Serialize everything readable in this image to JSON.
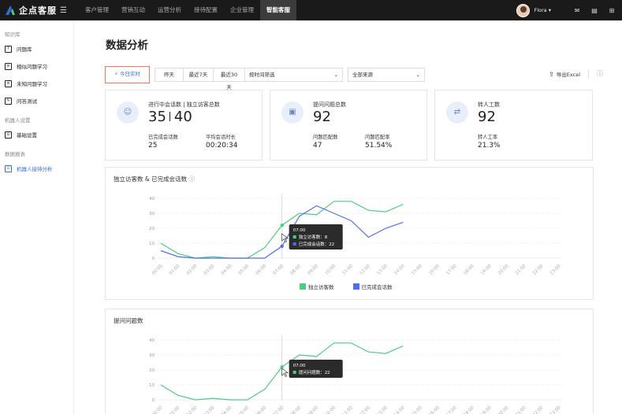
{
  "app": {
    "logo_text": "企点客服",
    "user": "Flora"
  },
  "nav": [
    {
      "label": "客户管理"
    },
    {
      "label": "营销互动"
    },
    {
      "label": "运营分析"
    },
    {
      "label": "接待配置"
    },
    {
      "label": "企业管理"
    },
    {
      "label": "智能客服"
    }
  ],
  "sidebar": {
    "groups": [
      {
        "title": "知识库",
        "items": [
          "问题库",
          "相似问题学习",
          "未知问题学习",
          "问答测试"
        ]
      },
      {
        "title": "机器人设置",
        "items": [
          "基础设置"
        ]
      },
      {
        "title": "数据报表",
        "items": [
          "机器人接待分析"
        ]
      }
    ]
  },
  "page": {
    "title": "数据分析"
  },
  "filters": {
    "today": "今日实时",
    "range": [
      "昨天",
      "最近7天",
      "最近30天"
    ],
    "time_filter": "按时间筛选",
    "source": "全部来源"
  },
  "export": {
    "label": "导出Excel"
  },
  "cards": [
    {
      "title": "进行中会话数 | 独立访客总数",
      "big_a": "35",
      "big_b": "40",
      "sub1": "已完成会话数",
      "val1": "25",
      "sub2": "平均会话时长",
      "val2": "00:20:34"
    },
    {
      "title": "提问问题总数",
      "big": "92",
      "sub1": "问题匹配数",
      "val1": "47",
      "sub2": "问题匹配率",
      "val2": "51.54%"
    },
    {
      "title": "转人工数",
      "big": "92",
      "sub1": "转人工率",
      "val1": "21.3%"
    }
  ],
  "colors": {
    "green": "#4ccd84",
    "blue": "#4f6fe8",
    "accent": "#2f6fdd",
    "highlight": "#f0785a"
  },
  "chart_data": [
    {
      "type": "line",
      "title": "独立访客数 & 已完成会话数",
      "x": [
        "00:00",
        "01:00",
        "02:00",
        "03:00",
        "04:00",
        "05:00",
        "06:00",
        "07:00",
        "08:00",
        "09:00",
        "10:00",
        "11:00",
        "12:00",
        "13:00",
        "14:00",
        "15:00",
        "16:00",
        "17:00",
        "18:00",
        "19:00",
        "20:00",
        "21:00",
        "22:00",
        "23:00"
      ],
      "yticks": [
        0,
        10,
        20,
        30,
        40
      ],
      "ylim": [
        0,
        40
      ],
      "series": [
        {
          "name": "独立访客数",
          "color": "#4ccd84",
          "values": [
            10,
            3,
            0,
            1,
            0,
            0,
            7,
            22,
            30,
            29,
            38,
            38,
            32,
            31,
            36,
            null,
            null,
            null,
            null,
            null,
            null,
            null,
            null,
            null
          ]
        },
        {
          "name": "已完成会话数",
          "color": "#4f6fe8",
          "values": [
            5,
            1,
            0,
            0,
            0,
            0,
            0,
            8,
            28,
            35,
            30,
            25,
            14,
            20,
            24,
            null,
            null,
            null,
            null,
            null,
            null,
            null,
            null,
            null
          ]
        }
      ],
      "tooltip": {
        "time": "07:00",
        "rows": [
          {
            "label": "独立访客数：",
            "value": "8"
          },
          {
            "label": "已完成会话数：",
            "value": "22"
          }
        ]
      }
    },
    {
      "type": "line",
      "title": "提问问题数",
      "x": [
        "00:00",
        "01:00",
        "02:00",
        "03:00",
        "04:00",
        "05:00",
        "06:00",
        "07:00",
        "08:00",
        "09:00",
        "10:00",
        "11:00",
        "12:00",
        "13:00",
        "14:00",
        "15:00",
        "16:00",
        "17:00",
        "18:00",
        "19:00",
        "20:00",
        "21:00",
        "22:00",
        "23:00"
      ],
      "yticks": [
        0,
        10,
        20,
        30,
        40
      ],
      "ylim": [
        0,
        40
      ],
      "series": [
        {
          "name": "提问问题数",
          "color": "#4ccd84",
          "values": [
            10,
            3,
            0,
            1,
            0,
            0,
            7,
            22,
            30,
            29,
            38,
            38,
            32,
            31,
            36,
            null,
            null,
            null,
            null,
            null,
            null,
            null,
            null,
            null
          ]
        }
      ],
      "tooltip": {
        "time": "07:00",
        "rows": [
          {
            "label": "提问问题数：",
            "value": "22"
          }
        ]
      }
    }
  ]
}
